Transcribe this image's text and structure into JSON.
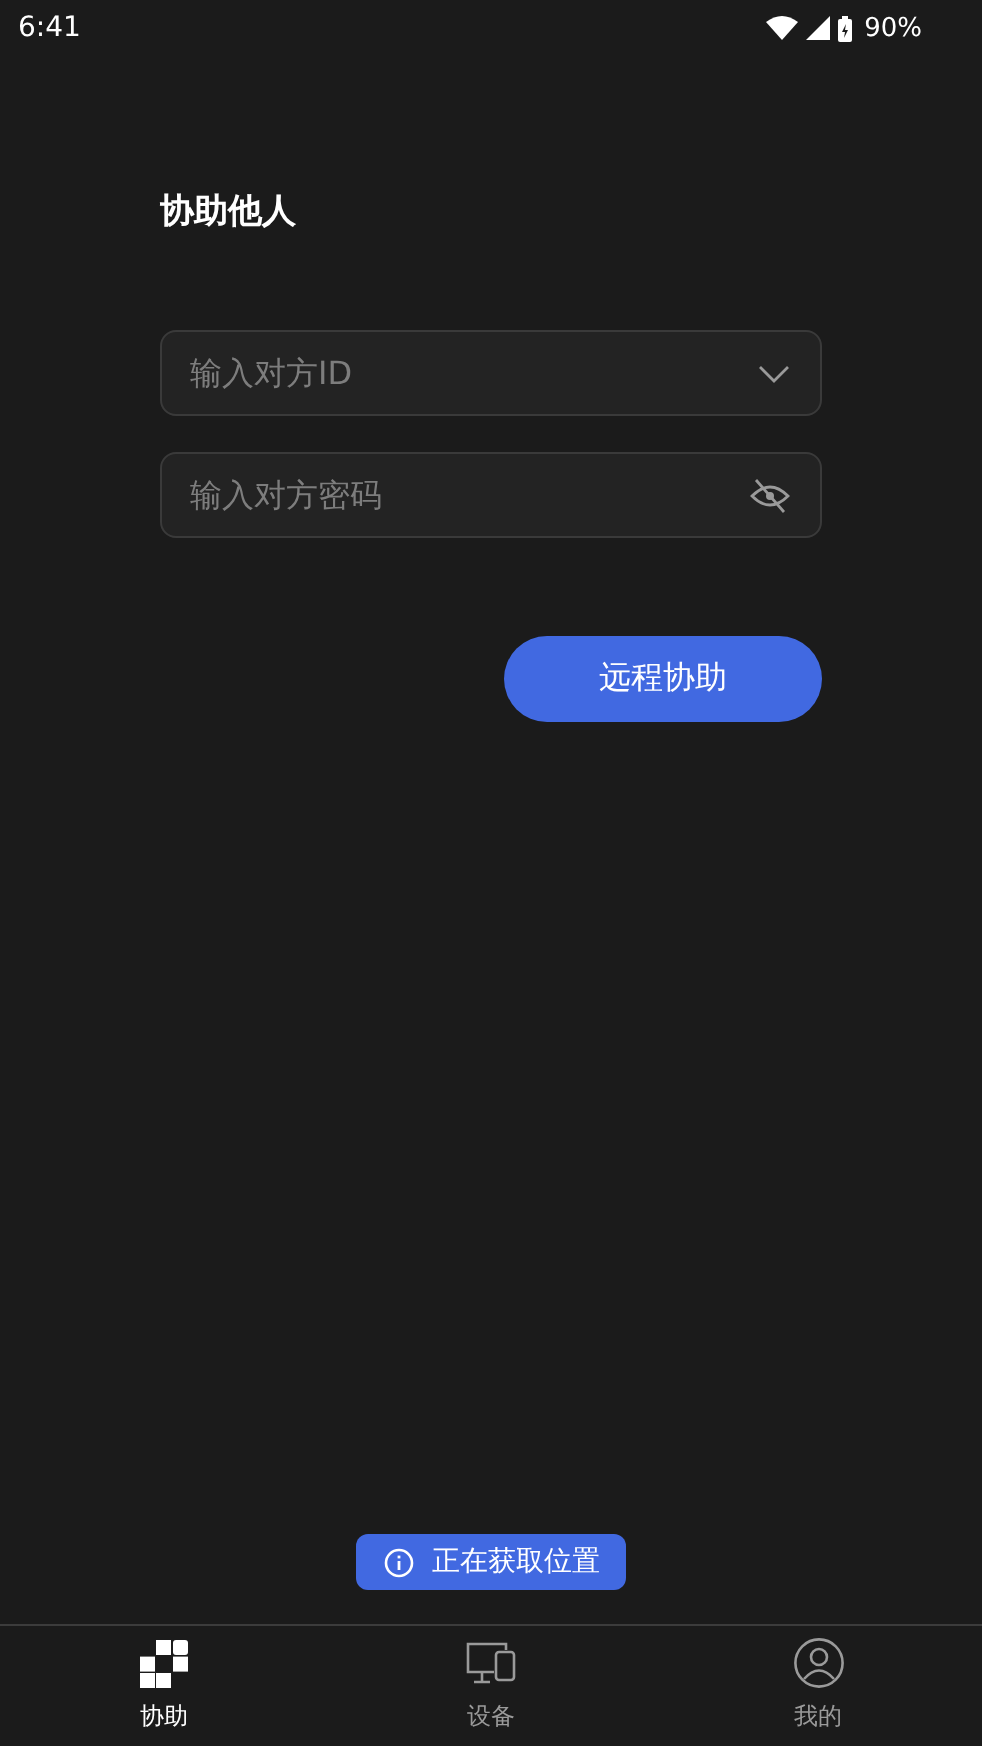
{
  "status_bar": {
    "time": "6:41",
    "battery": "90%"
  },
  "title": "协助他人",
  "fields": [
    {
      "kind": "dropdown",
      "placeholder": "输入对方ID"
    },
    {
      "kind": "password",
      "placeholder": "输入对方密码"
    }
  ],
  "submit_button": "远程协助",
  "toast": "正在获取位置",
  "tabs": [
    {
      "label": "协助",
      "kind": "assist",
      "selected": true
    },
    {
      "label": "设备",
      "kind": "devices",
      "selected": false
    },
    {
      "label": "我的",
      "kind": "profile",
      "selected": false
    }
  ]
}
